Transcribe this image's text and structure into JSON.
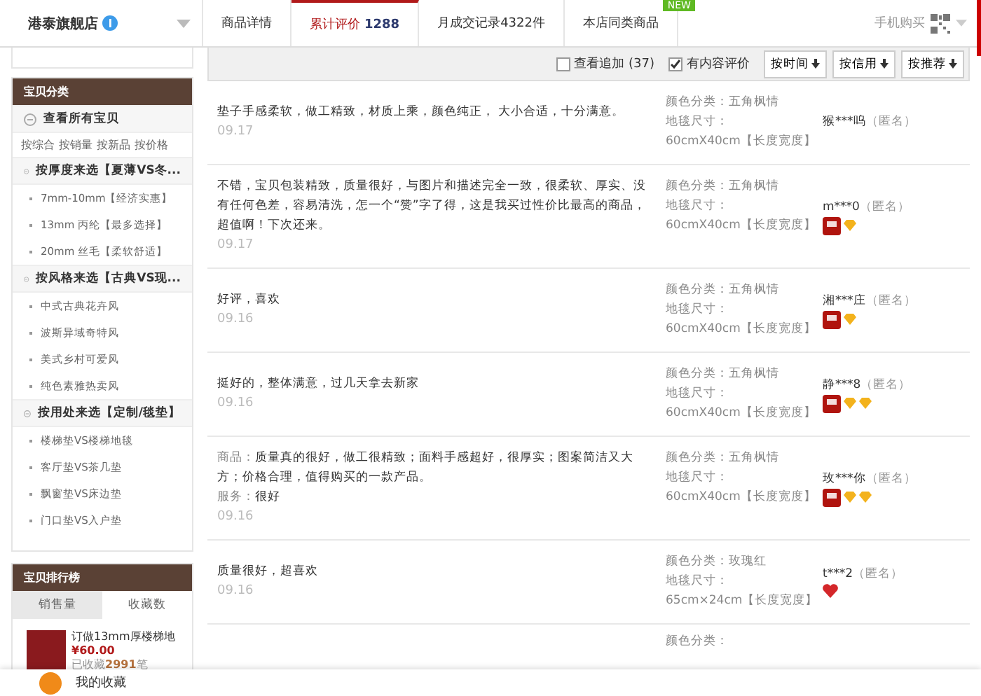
{
  "shop": {
    "name": "港泰旗舰店"
  },
  "tabs": [
    {
      "label": "商品详情",
      "selected": false
    },
    {
      "label": "累计评价",
      "count": "1288",
      "selected": true
    },
    {
      "label": "月成交记录4322件",
      "selected": false
    },
    {
      "label": "本店同类商品",
      "selected": false,
      "badge": "NEW"
    }
  ],
  "mobile_buy": "手机购买",
  "sidebar": {
    "title": "宝贝分类",
    "all": "查看所有宝贝",
    "sorts": [
      "按综合",
      "按销量",
      "按新品",
      "按价格"
    ],
    "groups": [
      {
        "title": "按厚度来选【夏薄VS冬...",
        "expanded": true,
        "children": [
          "7mm-10mm【经济实惠】",
          "13mm 丙纶【最多选择】",
          "20mm 丝毛【柔软舒适】"
        ]
      },
      {
        "title": "按风格来选【古典VS现...",
        "expanded": true,
        "children": [
          "中式古典花卉风",
          "波斯异域奇特风",
          "美式乡村可爱风",
          "纯色素雅热卖风"
        ]
      },
      {
        "title": "按用处来选【定制/毯垫】",
        "expanded": true,
        "children": [
          "楼梯垫VS楼梯地毯",
          "客厅垫VS茶几垫",
          "飘窗垫VS床边垫",
          "门口垫VS入户垫"
        ]
      }
    ]
  },
  "ranking": {
    "title": "宝贝排行榜",
    "tabs": [
      {
        "label": "销售量",
        "selected": false
      },
      {
        "label": "收藏数",
        "selected": true
      }
    ],
    "product": {
      "name": "订做13mm厚楼梯地",
      "price": "¥60.00",
      "favorites": "已收藏**2991**笔"
    }
  },
  "filters": [
    {
      "label": "查看追加 (37)",
      "checked": false
    },
    {
      "label": "有内容评价",
      "checked": true
    }
  ],
  "sort_buttons": [
    "按时间",
    "按信用",
    "按推荐"
  ],
  "reviews": [
    {
      "lines": [
        {
          "text": "垫子手感柔软，做工精致，材质上乘，颜色纯正， 大小合适，十分满意。"
        }
      ],
      "date": "09.17",
      "color_label": "颜色分类：",
      "color_value": "五角枫情",
      "size_label": "地毯尺寸：",
      "size": "60cmX40cm【长度宽度】",
      "user": "猴***呜",
      "anon": "（匿名）"
    },
    {
      "lines": [
        {
          "text": "不错，宝贝包装精致，质量很好，与图片和描述完全一致，很柔软、厚实、没有任何色差，容易清洗，怎一个“赞”字了得，这是我买过性价比最高的商品，超值啊！下次还来。"
        }
      ],
      "date": "09.17",
      "color_label": "颜色分类：",
      "color_value": "五角枫情",
      "size_label": "地毯尺寸：",
      "size": "60cmX40cm【长度宽度】",
      "user": "m***0",
      "anon": "（匿名）",
      "badges": [
        {
          "kind": "level"
        },
        {
          "kind": "diamond"
        }
      ]
    },
    {
      "lines": [
        {
          "text": "好评，喜欢"
        }
      ],
      "date": "09.16",
      "color_label": "颜色分类：",
      "color_value": "五角枫情",
      "size_label": "地毯尺寸：",
      "size": "60cmX40cm【长度宽度】",
      "user": "湘***庄",
      "anon": "（匿名）",
      "badges": [
        {
          "kind": "level"
        },
        {
          "kind": "diamond"
        }
      ]
    },
    {
      "lines": [
        {
          "text": "挺好的，整体满意，过几天拿去新家"
        }
      ],
      "date": "09.16",
      "color_label": "颜色分类：",
      "color_value": "五角枫情",
      "size_label": "地毯尺寸：",
      "size": "60cmX40cm【长度宽度】",
      "user": "静***8",
      "anon": "（匿名）",
      "badges": [
        {
          "kind": "level"
        },
        {
          "kind": "diamond"
        },
        {
          "kind": "diamond"
        }
      ]
    },
    {
      "lines": [
        {
          "label": "商品：",
          "text": "质量真的很好，做工很精致；面料手感超好，很厚实；图案简洁又大方；价格合理，值得购买的一款产品。"
        },
        {
          "label": "服务：",
          "text": "很好"
        }
      ],
      "date": "09.16",
      "color_label": "颜色分类：",
      "color_value": "五角枫情",
      "size_label": "地毯尺寸：",
      "size": "60cmX40cm【长度宽度】",
      "user": "玫***你",
      "anon": "（匿名）",
      "badges": [
        {
          "kind": "level"
        },
        {
          "kind": "diamond"
        },
        {
          "kind": "diamond"
        }
      ]
    },
    {
      "lines": [
        {
          "text": "质量很好，超喜欢"
        }
      ],
      "date": "09.16",
      "color_label": "颜色分类：",
      "color_value": "玫瑰红",
      "size_label": "地毯尺寸：",
      "size": "65cm×24cm【长度宽度】",
      "user": "t***2",
      "anon": "（匿名）",
      "badges": [
        {
          "kind": "heart"
        }
      ]
    }
  ],
  "partial_row_label": "颜色分类：",
  "bottom_bar": {
    "label": "我的收藏"
  }
}
